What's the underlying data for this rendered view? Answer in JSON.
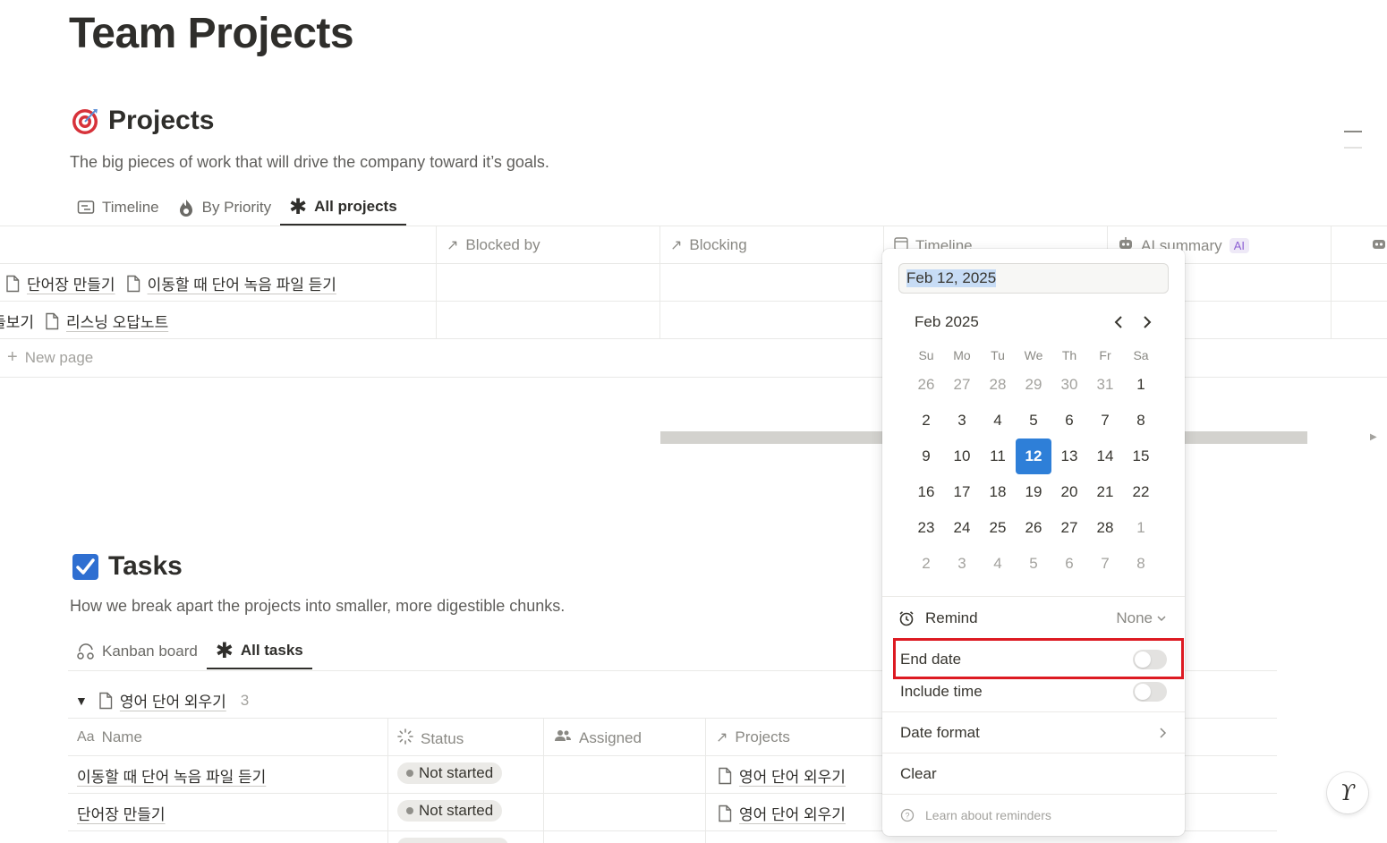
{
  "page": {
    "title": "Team Projects"
  },
  "projects": {
    "title": "Projects",
    "description": "The big pieces of work that will drive the company toward it’s goals.",
    "tabs": [
      {
        "label": "Timeline",
        "icon": "timeline-icon",
        "active": false
      },
      {
        "label": "By Priority",
        "icon": "flame-icon",
        "active": false
      },
      {
        "label": "All projects",
        "icon": "asterisk-icon",
        "active": true
      }
    ],
    "columns": [
      {
        "label": "Blocked by",
        "icon": "arrow-up-right-icon"
      },
      {
        "label": "Blocking",
        "icon": "arrow-up-right-icon"
      },
      {
        "label": "Timeline",
        "icon": "calendar-icon"
      },
      {
        "label": "AI summary",
        "icon": "robot-icon",
        "chip": "AI"
      }
    ],
    "rows": [
      {
        "items": [
          "단어장 만들기",
          "이동할 때 단어 녹음 파일 듣기"
        ]
      },
      {
        "prefix": "들보기",
        "items": [
          "리스닝 오답노트"
        ]
      }
    ],
    "new_page": "New page"
  },
  "tasks": {
    "title": "Tasks",
    "description": "How we break apart the projects into smaller, more digestible chunks.",
    "tabs": [
      {
        "label": "Kanban board",
        "icon": "kanban-icon",
        "active": false
      },
      {
        "label": "All tasks",
        "icon": "asterisk-icon",
        "active": true
      }
    ],
    "group": {
      "label": "영어 단어 외우기",
      "count": "3"
    },
    "columns": [
      {
        "label": "Name",
        "icon": "text-aa-icon",
        "prefix": "Aa"
      },
      {
        "label": "Status",
        "icon": "status-sparkle-icon"
      },
      {
        "label": "Assigned",
        "icon": "people-icon"
      },
      {
        "label": "Projects",
        "icon": "arrow-up-right-icon"
      }
    ],
    "rows": [
      {
        "name": "이동할 때 단어 녹음 파일 듣기",
        "status": "Not started",
        "project": "영어 단어 외우기"
      },
      {
        "name": "단어장 만들기",
        "status": "Not started",
        "project": "영어 단어 외우기"
      }
    ]
  },
  "datepicker": {
    "input_value": "Feb 12, 2025",
    "month_label": "Feb 2025",
    "weekdays": [
      "Su",
      "Mo",
      "Tu",
      "We",
      "Th",
      "Fr",
      "Sa"
    ],
    "weeks": [
      [
        "26",
        "27",
        "28",
        "29",
        "30",
        "31",
        "1"
      ],
      [
        "2",
        "3",
        "4",
        "5",
        "6",
        "7",
        "8"
      ],
      [
        "9",
        "10",
        "11",
        "12",
        "13",
        "14",
        "15"
      ],
      [
        "16",
        "17",
        "18",
        "19",
        "20",
        "21",
        "22"
      ],
      [
        "23",
        "24",
        "25",
        "26",
        "27",
        "28",
        "1"
      ],
      [
        "2",
        "3",
        "4",
        "5",
        "6",
        "7",
        "8"
      ]
    ],
    "selected_day": "12",
    "remind": {
      "label": "Remind",
      "value": "None"
    },
    "end_date": {
      "label": "End date",
      "on": false
    },
    "include_time": {
      "label": "Include time",
      "on": false
    },
    "date_format": {
      "label": "Date format"
    },
    "clear": {
      "label": "Clear"
    },
    "learn": {
      "label": "Learn about reminders"
    }
  },
  "colors": {
    "accent": "#2e7fd8",
    "highlight": "#dd1a22",
    "tasks_icon": "#2f6fd1",
    "projects_icon": "#d7323a"
  }
}
